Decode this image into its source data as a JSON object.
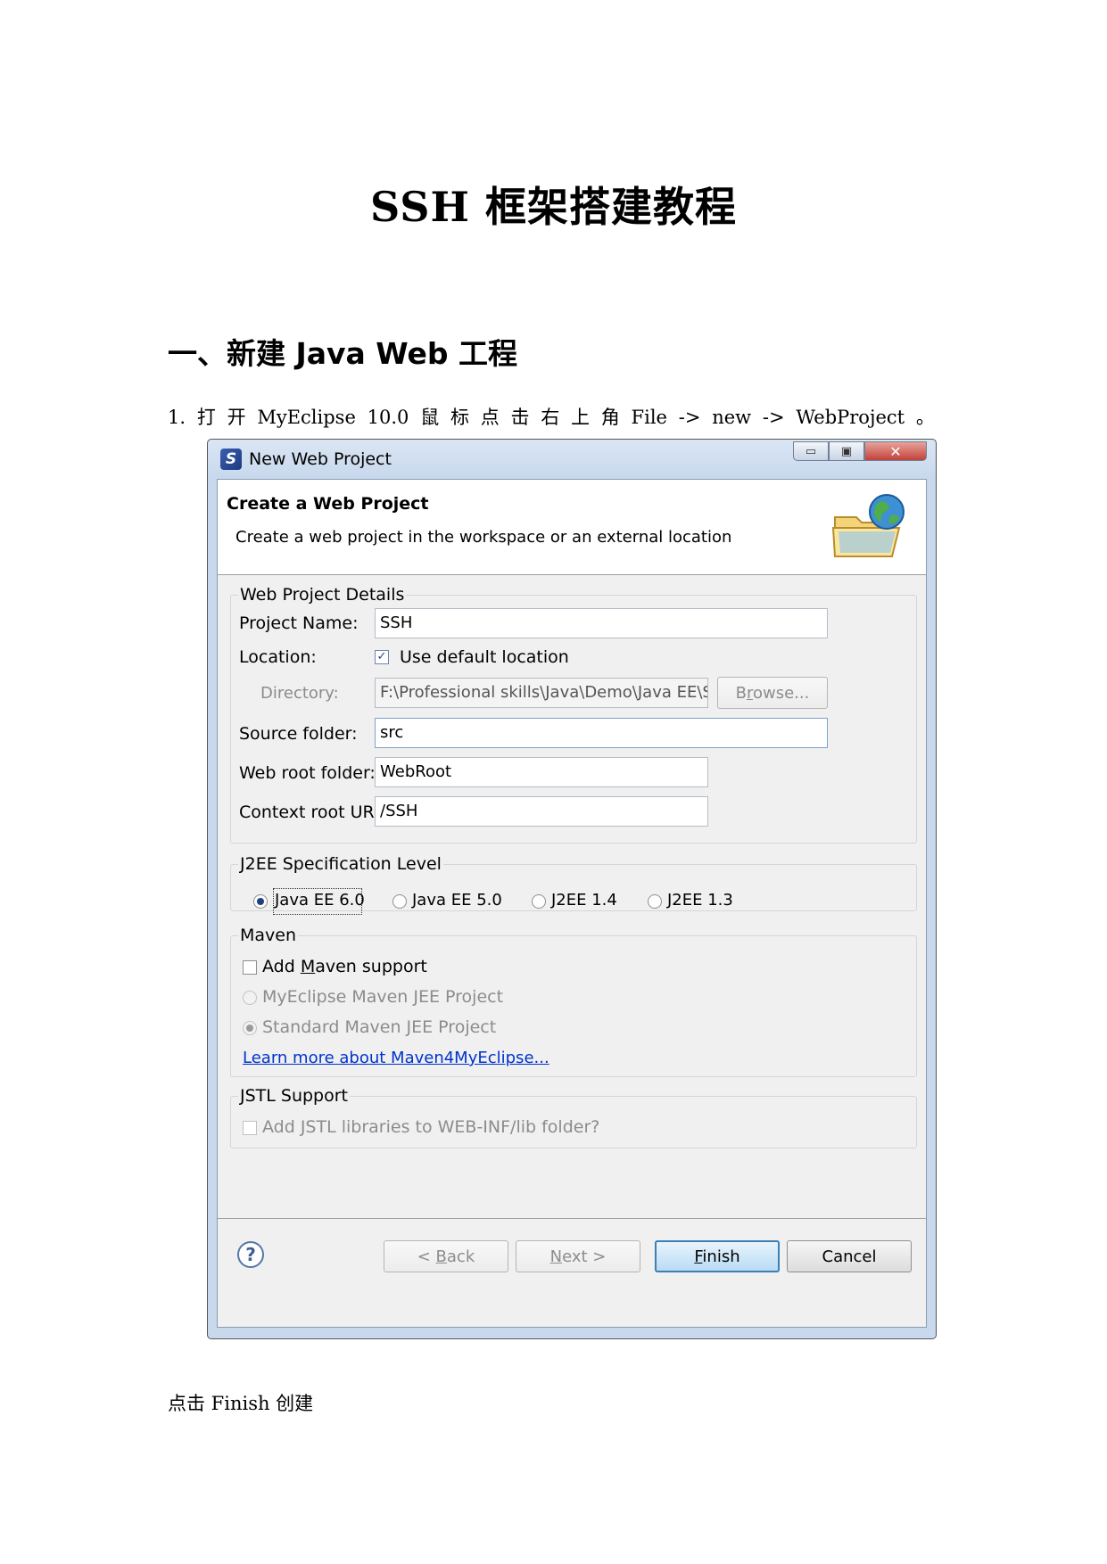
{
  "document": {
    "title": "SSH  框架搭建教程",
    "section_heading": "一、新建 Java Web 工程",
    "step_tokens": [
      "1.",
      "打",
      "开",
      "MyEclipse",
      "10.0",
      "鼠",
      "标",
      "点",
      "击",
      "右",
      "上",
      "角",
      "File",
      "->",
      "new",
      "->",
      "WebProject",
      "。"
    ],
    "caption": "点击 Finish  创建"
  },
  "dialog": {
    "window_title": "New Web Project",
    "app_icon_glyph": "S",
    "window_buttons": {
      "minimize": "▭",
      "maximize": "▣",
      "close": "✕"
    },
    "banner_title": "Create a Web Project",
    "banner_description": "Create a web project in the workspace or an external location",
    "banner_icon": "folder-globe-icon",
    "details": {
      "legend": "Web Project Details",
      "project_name_label": "Project Name:",
      "project_name_value": "SSH",
      "location_label": "Location:",
      "use_default_location_label": "Use default location",
      "use_default_location_checked": true,
      "directory_label": "Directory:",
      "directory_value": "F:\\Professional skills\\Java\\Demo\\Java EE\\Ser",
      "browse_label": "Browse...",
      "source_folder_label": "Source folder:",
      "source_folder_value": "src",
      "web_root_folder_label": "Web root folder:",
      "web_root_folder_value": "WebRoot",
      "context_root_label": "Context root URL:",
      "context_root_value": "/SSH"
    },
    "j2ee": {
      "legend": "J2EE Specification Level",
      "options": [
        "Java EE 6.0",
        "Java EE 5.0",
        "J2EE 1.4",
        "J2EE 1.3"
      ],
      "selected": "Java EE 6.0"
    },
    "maven": {
      "legend": "Maven",
      "add_support_label": "Add Maven support",
      "option_myeclipse": "MyEclipse Maven JEE Project",
      "option_standard": "Standard Maven JEE Project",
      "learn_more_link": "Learn more about Maven4MyEclipse..."
    },
    "jstl": {
      "legend": "JSTL Support",
      "add_jstl_label": "Add JSTL libraries to WEB-INF/lib folder?"
    },
    "footer": {
      "help_glyph": "?",
      "back_label": "< Back",
      "next_label": "Next >",
      "finish_label": "Finish",
      "cancel_label": "Cancel"
    }
  }
}
